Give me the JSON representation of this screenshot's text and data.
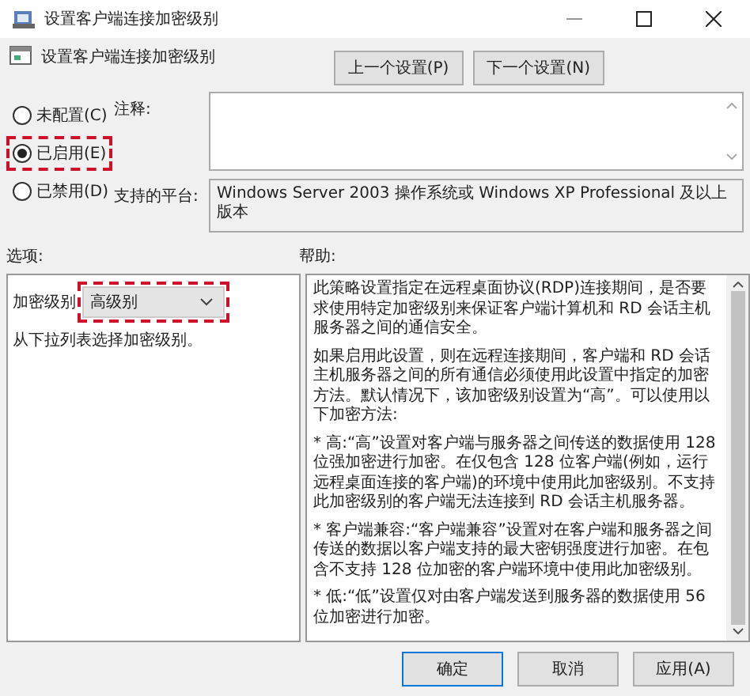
{
  "window": {
    "title": "设置客户端连接加密级别"
  },
  "header": {
    "title": "设置客户端连接加密级别",
    "buttons": [
      "上一个设置(P)",
      "下一个设置(N)"
    ]
  },
  "state_options": [
    {
      "label": "未配置(C)",
      "selected": false,
      "highlighted": false
    },
    {
      "label": "已启用(E)",
      "selected": true,
      "highlighted": true
    },
    {
      "label": "已禁用(D)",
      "selected": false,
      "highlighted": false
    }
  ],
  "comment": {
    "label": "注释:"
  },
  "platform": {
    "label": "支持的平台:",
    "value": "Windows Server 2003 操作系统或 Windows XP Professional 及以上版本"
  },
  "options": {
    "label": "选项:",
    "field_label": "加密级别",
    "dropdown_value": "高级别",
    "dropdown_highlighted": true,
    "hint": "从下拉列表选择加密级别。"
  },
  "help": {
    "label": "帮助:",
    "paragraphs": [
      "此策略设置指定在远程桌面协议(RDP)连接期间，是否要求使用特定加密级别来保证客户端计算机和 RD 会话主机服务器之间的通信安全。",
      "如果启用此设置，则在远程连接期间，客户端和 RD 会话主机服务器之间的所有通信必须使用此设置中指定的加密方法。默认情况下，该加密级别设置为“高”。可以使用以下加密方法:",
      "* 高:“高”设置对客户端与服务器之间传送的数据使用 128 位强加密进行加密。在仅包含 128 位客户端(例如，运行远程桌面连接的客户端)的环境中使用此加密级别。不支持此加密级别的客户端无法连接到 RD 会话主机服务器。",
      "* 客户端兼容:“客户端兼容”设置对在客户端和服务器之间传送的数据以客户端支持的最大密钥强度进行加密。在包含不支持 128 位加密的客户端环境中使用此加密级别。",
      "* 低:“低”设置仅对由客户端发送到服务器的数据使用 56 位加密进行加密。"
    ]
  },
  "buttons": [
    {
      "label": "确定",
      "kind": "default"
    },
    {
      "label": "取消",
      "kind": "normal"
    },
    {
      "label": "应用(A)",
      "kind": "normal"
    }
  ]
}
